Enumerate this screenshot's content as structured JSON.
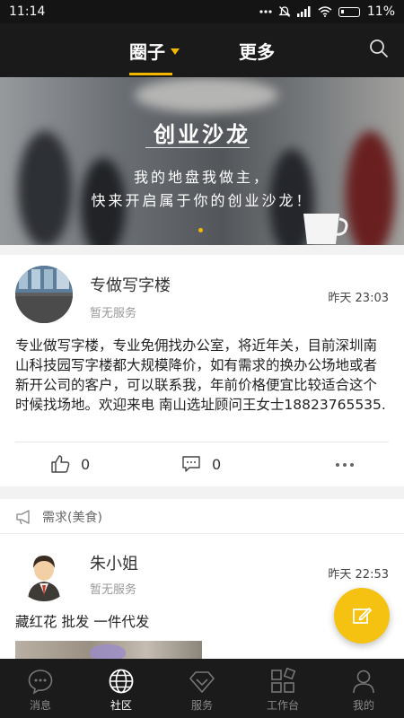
{
  "status_bar": {
    "time": "11:14",
    "battery": "11%"
  },
  "header": {
    "tabs": [
      {
        "label": "圈子",
        "active": true
      },
      {
        "label": "更多",
        "active": false
      }
    ],
    "accent_color": "#f5b800"
  },
  "banner": {
    "title": "创业沙龙",
    "line1": "我的地盘我做主，",
    "line2": "快来开启属于你的创业沙龙！"
  },
  "posts": [
    {
      "name": "专做写字楼",
      "service": "暂无服务",
      "time": "昨天 23:03",
      "body": "专业做写字楼，专业免佣找办公室，将近年关，目前深圳南山科技园写字楼都大规模降价，如有需求的换办公场地或者新开公司的客户，可以联系我，年前价格便宜比较适合这个时候找场地。欢迎来电 南山选址顾问王女士18823765535.",
      "likes": "0",
      "comments": "0"
    },
    {
      "category": "需求(美食)",
      "name": "朱小姐",
      "service": "暂无服务",
      "time": "昨天 22:53",
      "body": "藏红花 批发 一件代发"
    }
  ],
  "bottom_nav": [
    {
      "label": "消息",
      "icon": "chat-bubble-icon",
      "active": false
    },
    {
      "label": "社区",
      "icon": "globe-icon",
      "active": true
    },
    {
      "label": "服务",
      "icon": "diamond-icon",
      "active": false
    },
    {
      "label": "工作台",
      "icon": "workspace-icon",
      "active": false
    },
    {
      "label": "我的",
      "icon": "person-icon",
      "active": false
    }
  ]
}
